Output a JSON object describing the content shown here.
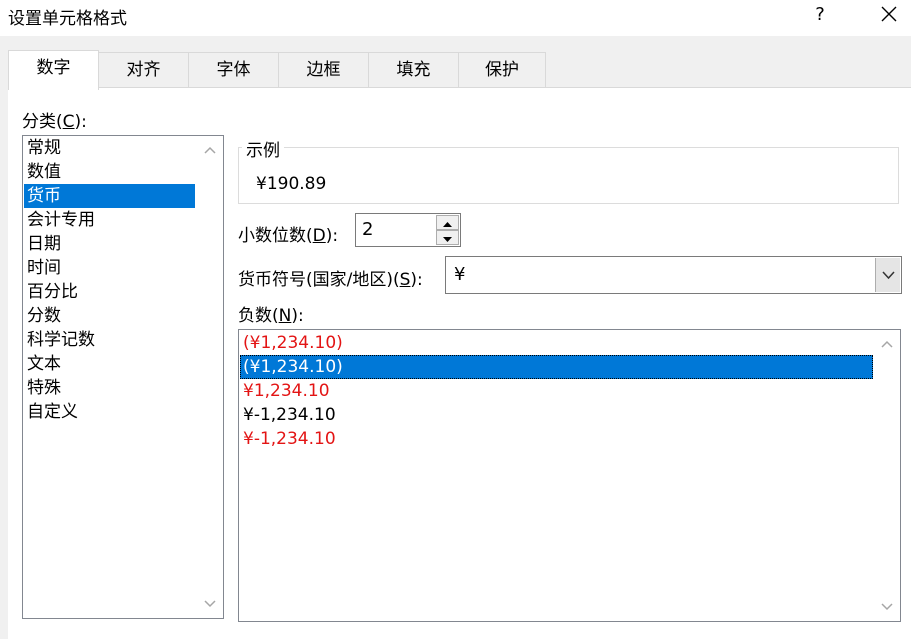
{
  "window": {
    "title": "设置单元格格式",
    "help_label": "?"
  },
  "tabs": [
    {
      "label": "数字",
      "active": true
    },
    {
      "label": "对齐"
    },
    {
      "label": "字体"
    },
    {
      "label": "边框"
    },
    {
      "label": "填充"
    },
    {
      "label": "保护"
    }
  ],
  "category": {
    "label_prefix": "分类(",
    "label_key": "C",
    "label_suffix": "):",
    "items": [
      "常规",
      "数值",
      "货币",
      "会计专用",
      "日期",
      "时间",
      "百分比",
      "分数",
      "科学记数",
      "文本",
      "特殊",
      "自定义"
    ],
    "selected": "货币"
  },
  "sample": {
    "legend": "示例",
    "value": "¥190.89"
  },
  "decimal": {
    "label_prefix": "小数位数(",
    "label_key": "D",
    "label_suffix": "):",
    "value": "2"
  },
  "currency_symbol": {
    "label_prefix": "货币符号(国家/地区)(",
    "label_key": "S",
    "label_suffix": "):",
    "value": "¥"
  },
  "negative": {
    "label_prefix": "负数(",
    "label_key": "N",
    "label_suffix": "):",
    "items": [
      {
        "text": "(¥1,234.10)",
        "color": "red"
      },
      {
        "text": "(¥1,234.10)",
        "color": "black",
        "selected": true
      },
      {
        "text": "¥1,234.10",
        "color": "red"
      },
      {
        "text": "¥-1,234.10",
        "color": "black"
      },
      {
        "text": "¥-1,234.10",
        "color": "red"
      }
    ]
  },
  "colors": {
    "selection": "#0078d7",
    "negative_red": "#e31414",
    "dialog_bg": "#f0f0f0"
  }
}
